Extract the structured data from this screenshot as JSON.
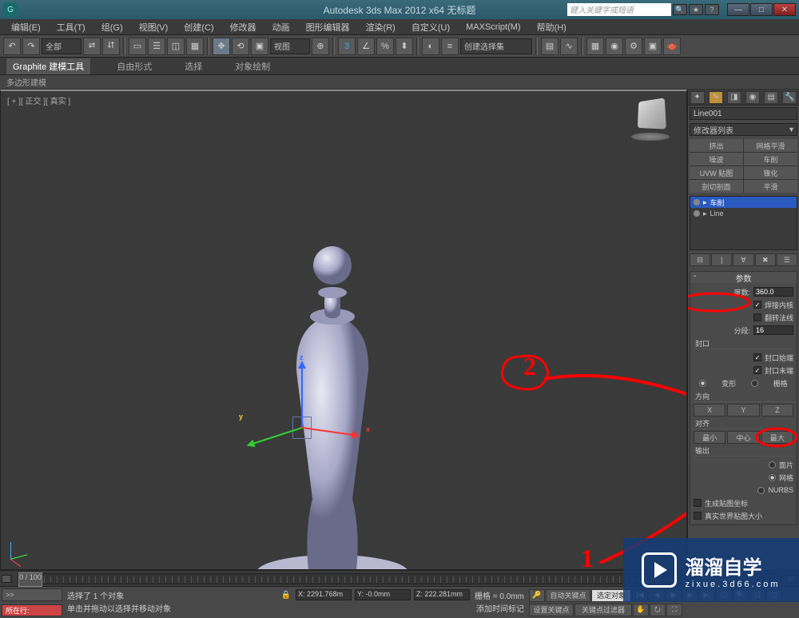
{
  "title": "Autodesk 3ds Max 2012 x64   无标题",
  "search_placeholder": "键入关键字或短语",
  "menu": [
    "编辑(E)",
    "工具(T)",
    "组(G)",
    "视图(V)",
    "创建(C)",
    "修改器",
    "动画",
    "图形编辑器",
    "渲染(R)",
    "自定义(U)",
    "MAXScript(M)",
    "帮助(H)"
  ],
  "toolbar": {
    "scope_drop": "全部",
    "view_drop": "视图",
    "selset_drop": "创建选择集"
  },
  "ribbon": {
    "tabs": [
      "Graphite 建模工具",
      "自由形式",
      "选择",
      "对象绘制"
    ],
    "sub": "多边形建模"
  },
  "viewport": {
    "label": "[ + ][ 正交 ][ 真实 ]",
    "axes": {
      "x": "x",
      "y": "y",
      "z": "z"
    }
  },
  "cmdpanel": {
    "object_name": "Line001",
    "modifier_drop": "修改器列表",
    "mod_buttons": [
      "挤出",
      "网格平滑",
      "噪波",
      "车削",
      "UVW 贴图",
      "锥化",
      "剖切剖面",
      "平滑"
    ],
    "stack": [
      {
        "label": "车削",
        "expanded": true,
        "selected": true
      },
      {
        "label": "Line",
        "expanded": true,
        "selected": false
      }
    ],
    "params": {
      "title": "参数",
      "degrees_label": "度数:",
      "degrees": "360.0",
      "weld_core": "焊接内核",
      "flip_normals": "翻转法线",
      "segments_label": "分段:",
      "segments": "16",
      "capping": {
        "title": "封口",
        "cap_start": "封口始端",
        "cap_end": "封口末端",
        "morph": "变形",
        "grid": "栅格"
      },
      "direction": {
        "title": "方向",
        "buttons": [
          "X",
          "Y",
          "Z"
        ]
      },
      "align": {
        "title": "对齐",
        "buttons": [
          "最小",
          "中心",
          "最大"
        ]
      },
      "output": {
        "title": "输出",
        "patch": "面片",
        "mesh": "网格",
        "nurbs": "NURBS"
      },
      "gen_map": "生成贴图坐标",
      "real_world": "真实世界贴图大小"
    }
  },
  "timeline": {
    "marker": "0 / 100"
  },
  "statusbar": {
    "command_btn": ">>",
    "current": "所在行:",
    "sel_info": "选择了 1 个对象",
    "prompt": "单击并拖动以选择并移动对象",
    "x": "X: 2291.768m",
    "y": "Y: -0.0mm",
    "z": "Z: 222.281mm",
    "grid": "栅格 = 0.0mm",
    "autokey": "自动关键点",
    "selkey": "选定对象",
    "setkey": "设置关键点",
    "keyfilter": "关键点过滤器",
    "add_time_tag": "添加时间标记"
  },
  "annotations": {
    "num1": "1",
    "num2": "2"
  },
  "watermark": {
    "big": "溜溜自学",
    "small": "zixue.3d66.com"
  }
}
